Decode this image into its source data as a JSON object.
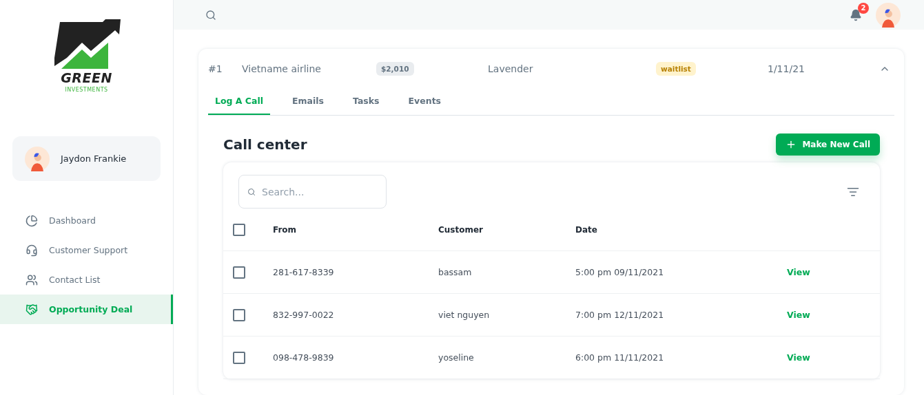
{
  "logo": {
    "name": "GREEN",
    "tagline": "INVESTMENTS"
  },
  "user": {
    "name": "Jaydon Frankie"
  },
  "nav": [
    {
      "label": "Dashboard",
      "selected": false
    },
    {
      "label": "Customer Support",
      "selected": false
    },
    {
      "label": "Contact List",
      "selected": false
    },
    {
      "label": "Opportunity Deal",
      "selected": true
    }
  ],
  "header": {
    "notifications": "2"
  },
  "deal": {
    "number": "#1",
    "name": "Vietname airline",
    "amount": "$2,010",
    "contact": "Lavender",
    "status": "waitlist",
    "date": "1/11/21",
    "expanded": true
  },
  "tabs": [
    {
      "label": "Log A Call",
      "selected": true
    },
    {
      "label": "Emails",
      "selected": false
    },
    {
      "label": "Tasks",
      "selected": false
    },
    {
      "label": "Events",
      "selected": false
    }
  ],
  "call_center": {
    "title": "Call center",
    "button": "Make New Call",
    "search": {
      "placeholder": "Search..."
    },
    "columns": [
      "From",
      "Customer",
      "Date"
    ],
    "all_checked": false,
    "rows": [
      {
        "from": "281-617-8339",
        "customer": "bassam",
        "date": "5:00 pm 09/11/2021",
        "action": "View",
        "checked": false
      },
      {
        "from": "832-997-0022",
        "customer": "viet nguyen",
        "date": "7:00 pm 12/11/2021",
        "action": "View",
        "checked": false
      },
      {
        "from": "098-478-9839",
        "customer": "yoseline",
        "date": "6:00 pm 11/11/2021",
        "action": "View",
        "checked": false
      }
    ]
  }
}
